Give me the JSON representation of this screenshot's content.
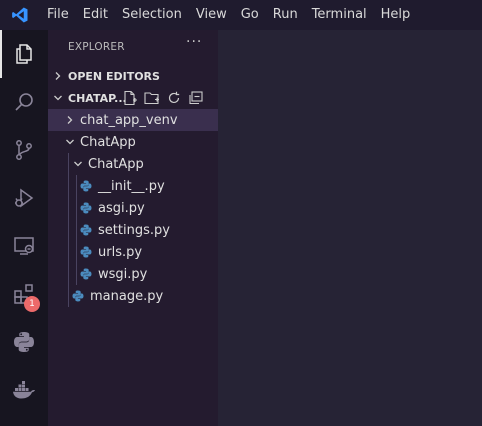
{
  "menu": [
    "File",
    "Edit",
    "Selection",
    "View",
    "Go",
    "Run",
    "Terminal",
    "Help"
  ],
  "activity": {
    "items": [
      "explorer-icon",
      "search-icon",
      "source-control-icon",
      "run-debug-icon",
      "remote-explorer-icon",
      "extensions-icon",
      "python-icon",
      "docker-icon"
    ],
    "extensions_badge": "1"
  },
  "explorer": {
    "title": "EXPLORER",
    "more": "···",
    "open_editors": "OPEN EDITORS",
    "workspace": "CHATAP...",
    "tree": {
      "venv": "chat_app_venv",
      "chatapp_root": "ChatApp",
      "chatapp_pkg": "ChatApp",
      "files": [
        "__init__.py",
        "asgi.py",
        "settings.py",
        "urls.py",
        "wsgi.py"
      ],
      "manage": "manage.py"
    }
  },
  "colors": {
    "accent": "#3794ff",
    "python_blue": "#4b8bbe",
    "badge": "#ec6a6a"
  }
}
